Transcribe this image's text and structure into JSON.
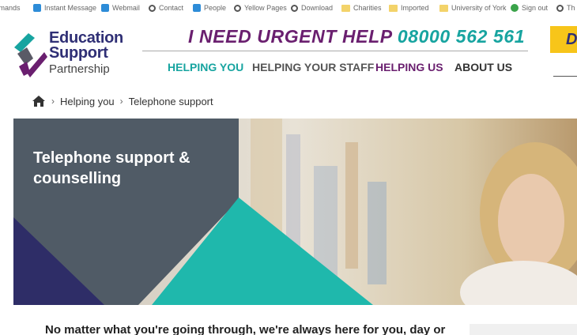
{
  "bookmarks": [
    {
      "label": "Imands",
      "icon": "none"
    },
    {
      "label": "Instant Message",
      "icon": "chat-icon"
    },
    {
      "label": "Webmail",
      "icon": "mail-icon"
    },
    {
      "label": "Contact",
      "icon": "globe-icon"
    },
    {
      "label": "People",
      "icon": "people-icon"
    },
    {
      "label": "Yellow Pages",
      "icon": "globe-icon"
    },
    {
      "label": "Download",
      "icon": "globe-icon"
    },
    {
      "label": "Charities",
      "icon": "folder-icon"
    },
    {
      "label": "Imported",
      "icon": "folder-icon"
    },
    {
      "label": "University of York",
      "icon": "folder-icon"
    },
    {
      "label": "Sign out",
      "icon": "google-icon"
    },
    {
      "label": "Th",
      "icon": "globe-icon"
    }
  ],
  "logo": {
    "line1": "Education",
    "line2": "Support",
    "line3": "Partnership"
  },
  "urgent": {
    "prefix": "I NEED URGENT HELP",
    "phone": "08000 562 561"
  },
  "cta": {
    "label": "D"
  },
  "nav": [
    {
      "label": "HELPING YOU"
    },
    {
      "label": "HELPING YOUR STAFF"
    },
    {
      "label": "HELPING US"
    },
    {
      "label": "ABOUT US"
    }
  ],
  "breadcrumb": {
    "items": [
      "Helping you",
      "Telephone support"
    ]
  },
  "hero": {
    "title": "Telephone support & counselling"
  },
  "intro": {
    "text": "No matter what you're going through, we're always here for you, day or"
  },
  "colors": {
    "purple": "#6a1f6f",
    "teal": "#17a4a0",
    "navy": "#2f2f75",
    "yellow": "#f7c51a",
    "slate": "#505b66"
  }
}
